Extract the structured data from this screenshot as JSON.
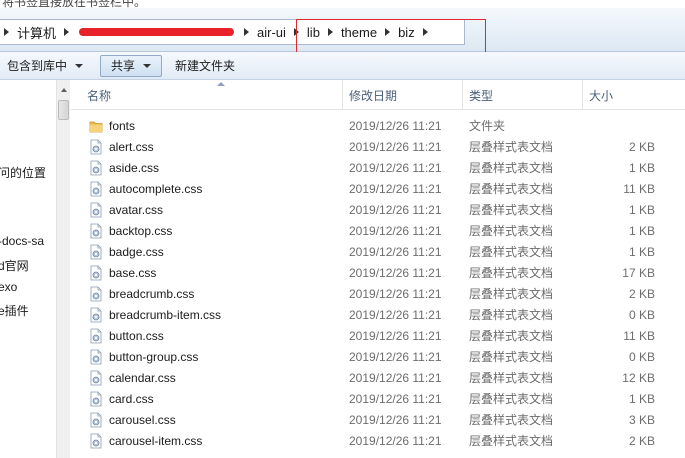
{
  "top_text": "将书签直接放在书签栏中。",
  "address": {
    "crumbs": [
      "计算机",
      "air-ui",
      "lib",
      "theme",
      "biz"
    ]
  },
  "toolbar": {
    "include_label": "包含到库中",
    "share_label": "共享",
    "new_folder_label": "新建文件夹"
  },
  "nav": {
    "items": [
      "问的位置",
      "-docs-sa",
      "d官网",
      "exo",
      "e插件"
    ]
  },
  "columns": {
    "name": "名称",
    "date": "修改日期",
    "type": "类型",
    "size": "大小"
  },
  "files": [
    {
      "name": "fonts",
      "date": "2019/12/26 11:21",
      "type": "文件夹",
      "size": "",
      "icon": "folder-icon"
    },
    {
      "name": "alert.css",
      "date": "2019/12/26 11:21",
      "type": "层叠样式表文档",
      "size": "2 KB",
      "icon": "css-file-icon"
    },
    {
      "name": "aside.css",
      "date": "2019/12/26 11:21",
      "type": "层叠样式表文档",
      "size": "1 KB",
      "icon": "css-file-icon"
    },
    {
      "name": "autocomplete.css",
      "date": "2019/12/26 11:21",
      "type": "层叠样式表文档",
      "size": "11 KB",
      "icon": "css-file-icon"
    },
    {
      "name": "avatar.css",
      "date": "2019/12/26 11:21",
      "type": "层叠样式表文档",
      "size": "1 KB",
      "icon": "css-file-icon"
    },
    {
      "name": "backtop.css",
      "date": "2019/12/26 11:21",
      "type": "层叠样式表文档",
      "size": "1 KB",
      "icon": "css-file-icon"
    },
    {
      "name": "badge.css",
      "date": "2019/12/26 11:21",
      "type": "层叠样式表文档",
      "size": "1 KB",
      "icon": "css-file-icon"
    },
    {
      "name": "base.css",
      "date": "2019/12/26 11:21",
      "type": "层叠样式表文档",
      "size": "17 KB",
      "icon": "css-file-icon"
    },
    {
      "name": "breadcrumb.css",
      "date": "2019/12/26 11:21",
      "type": "层叠样式表文档",
      "size": "2 KB",
      "icon": "css-file-icon"
    },
    {
      "name": "breadcrumb-item.css",
      "date": "2019/12/26 11:21",
      "type": "层叠样式表文档",
      "size": "0 KB",
      "icon": "css-file-icon"
    },
    {
      "name": "button.css",
      "date": "2019/12/26 11:21",
      "type": "层叠样式表文档",
      "size": "11 KB",
      "icon": "css-file-icon"
    },
    {
      "name": "button-group.css",
      "date": "2019/12/26 11:21",
      "type": "层叠样式表文档",
      "size": "0 KB",
      "icon": "css-file-icon"
    },
    {
      "name": "calendar.css",
      "date": "2019/12/26 11:21",
      "type": "层叠样式表文档",
      "size": "12 KB",
      "icon": "css-file-icon"
    },
    {
      "name": "card.css",
      "date": "2019/12/26 11:21",
      "type": "层叠样式表文档",
      "size": "1 KB",
      "icon": "css-file-icon"
    },
    {
      "name": "carousel.css",
      "date": "2019/12/26 11:21",
      "type": "层叠样式表文档",
      "size": "3 KB",
      "icon": "css-file-icon"
    },
    {
      "name": "carousel-item.css",
      "date": "2019/12/26 11:21",
      "type": "层叠样式表文档",
      "size": "2 KB",
      "icon": "css-file-icon"
    }
  ]
}
